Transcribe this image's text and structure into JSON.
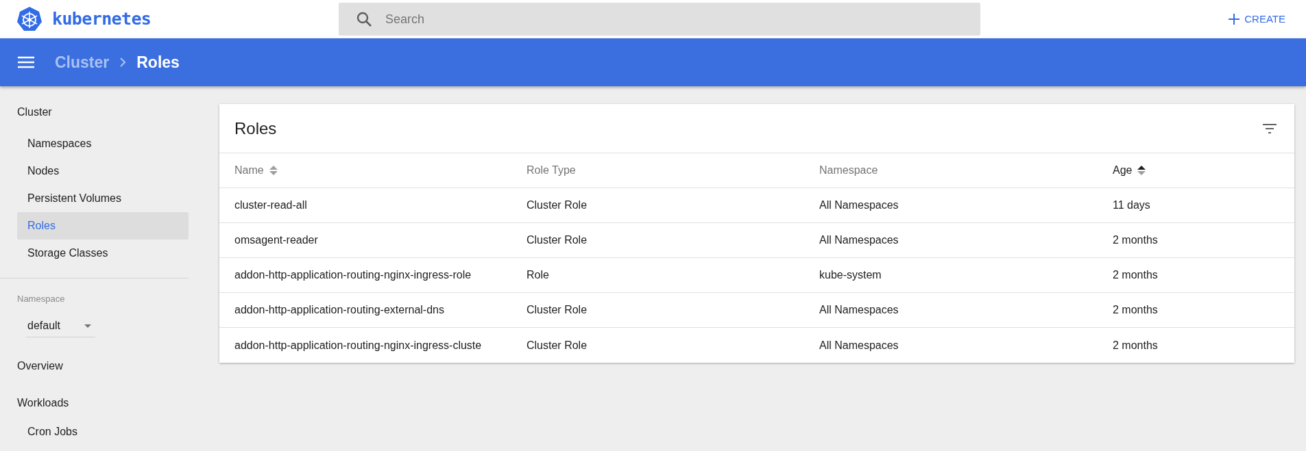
{
  "header": {
    "logo_text": "kubernetes",
    "search": {
      "placeholder": "Search"
    },
    "create_button": "CREATE"
  },
  "toolbar": {
    "breadcrumbs": [
      {
        "label": "Cluster",
        "current": false
      },
      {
        "label": "Roles",
        "current": true
      }
    ]
  },
  "sidebar": {
    "sections": [
      {
        "kind": "group",
        "title": "Cluster",
        "items": [
          {
            "label": "Namespaces",
            "selected": false
          },
          {
            "label": "Nodes",
            "selected": false
          },
          {
            "label": "Persistent Volumes",
            "selected": false
          },
          {
            "label": "Roles",
            "selected": true
          },
          {
            "label": "Storage Classes",
            "selected": false
          }
        ]
      },
      {
        "kind": "namespace",
        "title": "Namespace",
        "value": "default"
      },
      {
        "kind": "group",
        "title": "Overview"
      },
      {
        "kind": "group",
        "title": "Workloads",
        "items": [
          {
            "label": "Cron Jobs",
            "selected": false
          }
        ]
      }
    ]
  },
  "card": {
    "title": "Roles",
    "table": {
      "columns": [
        {
          "label": "Name",
          "sortable": true,
          "sorted": false
        },
        {
          "label": "Role Type",
          "sortable": false,
          "sorted": false
        },
        {
          "label": "Namespace",
          "sortable": false,
          "sorted": false
        },
        {
          "label": "Age",
          "sortable": true,
          "sorted": true
        }
      ],
      "rows": [
        [
          "cluster-read-all",
          "Cluster Role",
          "All Namespaces",
          "11 days"
        ],
        [
          "omsagent-reader",
          "Cluster Role",
          "All Namespaces",
          "2 months"
        ],
        [
          "addon-http-application-routing-nginx-ingress-role",
          "Role",
          "kube-system",
          "2 months"
        ],
        [
          "addon-http-application-routing-external-dns",
          "Cluster Role",
          "All Namespaces",
          "2 months"
        ],
        [
          "addon-http-application-routing-nginx-ingress-cluste",
          "Cluster Role",
          "All Namespaces",
          "2 months"
        ]
      ]
    }
  }
}
